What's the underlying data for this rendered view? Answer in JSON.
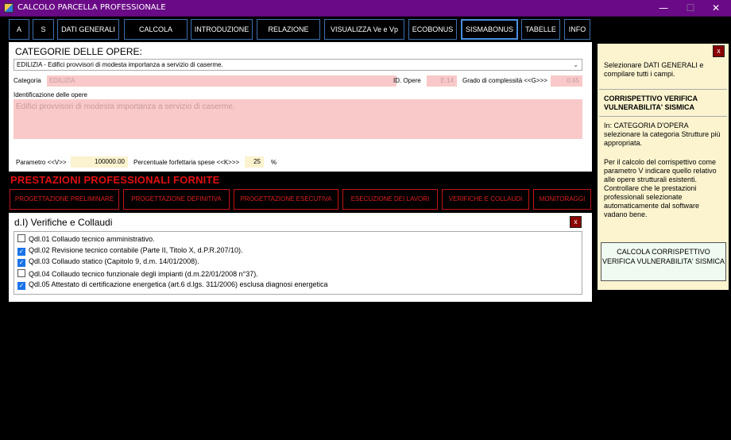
{
  "window": {
    "title": "CALCOLO PARCELLA PROFESSIONALE",
    "min_glyph": "—",
    "max_glyph": "☐",
    "close_glyph": "✕"
  },
  "nav": {
    "items": [
      "A",
      "S",
      "DATI GENERALI",
      "CALCOLA",
      "INTRODUZIONE",
      "RELAZIONE",
      "VISUALIZZA Ve e Vp",
      "ECOBONUS",
      "SISMABONUS",
      "TABELLE",
      "INFO"
    ],
    "active": "SISMABONUS"
  },
  "categorie": {
    "title": "CATEGORIE DELLE OPERE:",
    "selected": "EDILIZIA - Edifici provvisori di modesta importanza a servizio di caserme.",
    "categoria_label": "Categoria",
    "categoria_value": "EDILIZIA",
    "id_opere_label": "ID. Opere",
    "id_opere_value": "E.14",
    "grado_label": "Grado di complessità <<G>>>",
    "grado_value": "0.65",
    "identificazione_label": "Identificazione delle opere",
    "identificazione_value": "Edifici provvisori di modesta importanza a servizio di caserme.",
    "parametro_label": "Parametro <<V>>",
    "parametro_value": "100000.00",
    "percentuale_label": "Percentuale forfettaria spese <<K>>>",
    "percentuale_value": "25",
    "percentuale_unit": "%"
  },
  "prestazioni": {
    "title": "PRESTAZIONI PROFESSIONALI FORNITE",
    "buttons": [
      "PROGETTAZIONE PRELIMINARE",
      "PROGETTAZIONE DEFINITIVA",
      "PROGETTAZIONE ESECUTIVA",
      "ESECUZIONE DEI LAVORI",
      "VERIFICHE E COLLAUDI",
      "MONITORAGGI"
    ]
  },
  "verifiche": {
    "title": "d.I) Verifiche e Collaudi",
    "close_label": "x",
    "items": [
      {
        "label": "Qdl.01 Collaudo tecnico amministrativo.",
        "checked": false
      },
      {
        "label": "Qdl.02 Revisione tecnico contabile (Parte II, Titolo X, d.P.R.207/10).",
        "checked": true
      },
      {
        "label": "Qdl.03 Collaudo statico (Capitolo 9, d.m. 14/01/2008).",
        "checked": true
      },
      {
        "label": "Qdl.04 Collaudo tecnico funzionale degli impianti (d.m.22/01/2008 n°37).",
        "checked": false
      },
      {
        "label": "Qdl.05  Attestato di certificazione energetica (art.6 d.lgs. 311/2006) esclusa diagnosi energetica",
        "checked": true
      }
    ]
  },
  "help": {
    "close_label": "x",
    "intro": "Selezionare DATI GENERALI e compilare tutti i campi.",
    "heading": "CORRISPETTIVO VERIFICA VULNERABILITA' SISMICA",
    "para1": "In: CATEGORIA D'OPERA selezionare la categoria Strutture più appropriata.",
    "para2": "Per il calcolo del corrispettivo come parametro V indicare quello relativo alle opere strutturali esistenti. Controllare che le prestazioni professionali selezionate automaticamente dal software vadano bene.",
    "button": "CALCOLA CORRISPETTIVO VERIFICA VULNERABILITA' SISMICA"
  },
  "colors": {
    "titlebar": "#6a0a86",
    "nav_border": "#3d6fae",
    "red": "#e10f0f",
    "pink_field": "#f9c9c9",
    "help_bg": "#fbf4cf"
  }
}
